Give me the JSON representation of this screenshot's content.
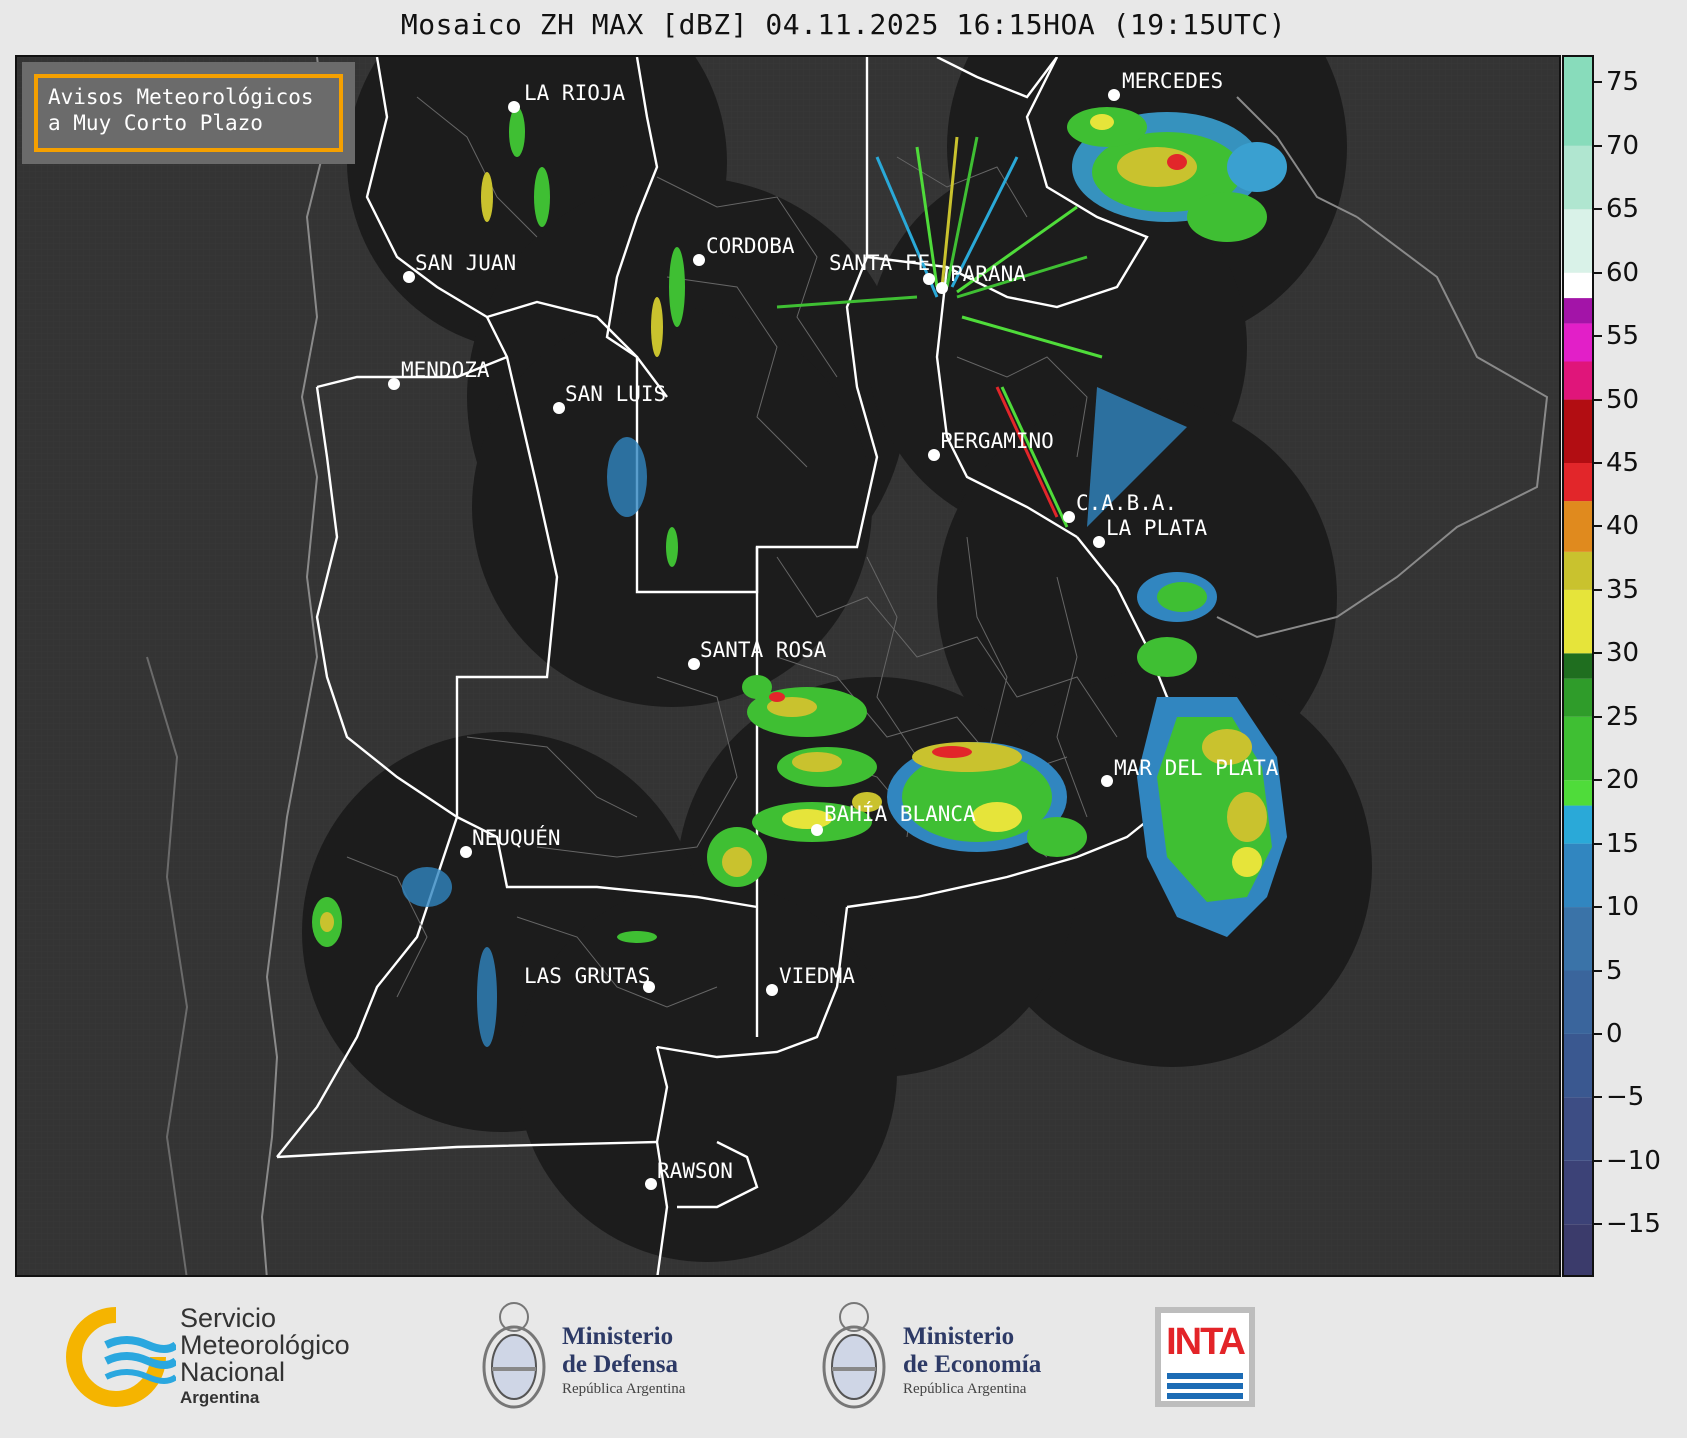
{
  "title": "Mosaico ZH MAX [dBZ] 04.11.2025 16:15HOA (19:15UTC)",
  "notice": {
    "line1": "Avisos Meteorológicos",
    "line2": "a Muy Corto Plazo"
  },
  "cities": [
    {
      "name": "LA RIOJA"
    },
    {
      "name": "MERCEDES"
    },
    {
      "name": "CORDOBA"
    },
    {
      "name": "SAN JUAN"
    },
    {
      "name": "SANTA FE"
    },
    {
      "name": "PARANA"
    },
    {
      "name": "MENDOZA"
    },
    {
      "name": "SAN LUIS"
    },
    {
      "name": "PERGAMINO"
    },
    {
      "name": "C.A.B.A."
    },
    {
      "name": "LA PLATA"
    },
    {
      "name": "SANTA ROSA"
    },
    {
      "name": "MAR DEL PLATA"
    },
    {
      "name": "BAHÍA BLANCA"
    },
    {
      "name": "NEUQUÉN"
    },
    {
      "name": "LAS GRUTAS"
    },
    {
      "name": "VIEDMA"
    },
    {
      "name": "RAWSON"
    }
  ],
  "colorbar": {
    "range": [
      -19,
      77
    ],
    "ticks": [
      "75",
      "70",
      "65",
      "60",
      "55",
      "50",
      "45",
      "40",
      "35",
      "30",
      "25",
      "20",
      "15",
      "10",
      "5",
      "0",
      "−5",
      "−10",
      "−15"
    ],
    "tick_values": [
      75,
      70,
      65,
      60,
      55,
      50,
      45,
      40,
      35,
      30,
      25,
      20,
      15,
      10,
      5,
      0,
      -5,
      -10,
      -15
    ],
    "bands": [
      {
        "from": -19,
        "to": -15,
        "color": "#3b3b6b"
      },
      {
        "from": -15,
        "to": -10,
        "color": "#3c4277"
      },
      {
        "from": -10,
        "to": -5,
        "color": "#3d4d84"
      },
      {
        "from": -5,
        "to": 0,
        "color": "#3a5890"
      },
      {
        "from": 0,
        "to": 5,
        "color": "#3a659c"
      },
      {
        "from": 5,
        "to": 10,
        "color": "#3a73a8"
      },
      {
        "from": 10,
        "to": 15,
        "color": "#3186c0"
      },
      {
        "from": 15,
        "to": 18,
        "color": "#2aa9d8"
      },
      {
        "from": 18,
        "to": 20,
        "color": "#4fdc3a"
      },
      {
        "from": 20,
        "to": 25,
        "color": "#3fbf33"
      },
      {
        "from": 25,
        "to": 28,
        "color": "#2f9c2a"
      },
      {
        "from": 28,
        "to": 30,
        "color": "#1f6e1f"
      },
      {
        "from": 30,
        "to": 35,
        "color": "#e6e43a"
      },
      {
        "from": 35,
        "to": 38,
        "color": "#c9c22e"
      },
      {
        "from": 38,
        "to": 42,
        "color": "#e08a1e"
      },
      {
        "from": 42,
        "to": 45,
        "color": "#e2262a"
      },
      {
        "from": 45,
        "to": 50,
        "color": "#b20d12"
      },
      {
        "from": 50,
        "to": 53,
        "color": "#e0157a"
      },
      {
        "from": 53,
        "to": 56,
        "color": "#e21fc8"
      },
      {
        "from": 56,
        "to": 58,
        "color": "#a314a8"
      },
      {
        "from": 58,
        "to": 60,
        "color": "#ffffff"
      },
      {
        "from": 60,
        "to": 65,
        "color": "#d9f2e8"
      },
      {
        "from": 65,
        "to": 70,
        "color": "#b0e6d0"
      },
      {
        "from": 70,
        "to": 77,
        "color": "#88dcbb"
      }
    ]
  },
  "logos": {
    "smn": {
      "line1": "Servicio",
      "line2": "Meteorológico",
      "line3": "Nacional",
      "line4": "Argentina"
    },
    "defensa": {
      "line1": "Ministerio",
      "line2": "de Defensa",
      "line3": "República Argentina"
    },
    "economia": {
      "line1": "Ministerio",
      "line2": "de Economía",
      "line3": "República Argentina"
    },
    "inta": {
      "label": "INTA"
    }
  },
  "colors": {
    "map_background": "#333333",
    "radar_coverage": "#1c1c1c",
    "province_border": "#ffffff",
    "notice_border": "#f5a000"
  }
}
